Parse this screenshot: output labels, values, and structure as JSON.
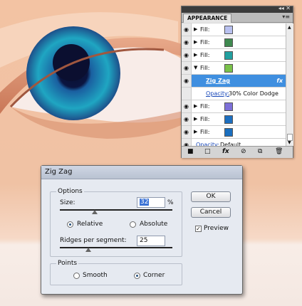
{
  "appearance_panel": {
    "tab": "APPEARANCE",
    "menu_icon": "panel-menu-icon",
    "rows": [
      {
        "label": "Fill:",
        "swatch": "#b9c1f0",
        "expanded": false
      },
      {
        "label": "Fill:",
        "swatch": "#3f8a50",
        "expanded": false
      },
      {
        "label": "Fill:",
        "swatch": "#22a0a0",
        "expanded": false
      },
      {
        "label": "Fill:",
        "swatch": "#7ac24a",
        "expanded": true
      },
      {
        "effect": "Zig Zag",
        "fx": "fx"
      },
      {
        "opacity_link": "Opacity:",
        "opacity_value": "30% Color Dodge"
      },
      {
        "label": "Fill:",
        "swatch": "#7d70d8",
        "expanded": false
      },
      {
        "label": "Fill:",
        "swatch": "#1d6fc0",
        "expanded": false
      },
      {
        "label": "Fill:",
        "swatch": "#1a6fbf",
        "expanded": false
      },
      {
        "opacity_link": "Opacity:",
        "opacity_value": "Default"
      }
    ],
    "bottom_icons": [
      "new-art-icon",
      "clear-appearance-icon",
      "add-effect-icon",
      "clear-icon",
      "duplicate-icon",
      "trash-icon"
    ]
  },
  "dialog": {
    "title": "Zig Zag",
    "options_legend": "Options",
    "size_label": "Size:",
    "size_value": "32",
    "size_unit": "%",
    "relative_label": "Relative",
    "absolute_label": "Absolute",
    "ridges_label": "Ridges per segment:",
    "ridges_value": "25",
    "points_legend": "Points",
    "smooth_label": "Smooth",
    "corner_label": "Corner",
    "ok_label": "OK",
    "cancel_label": "Cancel",
    "preview_label": "Preview",
    "relative_selected": true,
    "corner_selected": true,
    "preview_checked": true
  }
}
